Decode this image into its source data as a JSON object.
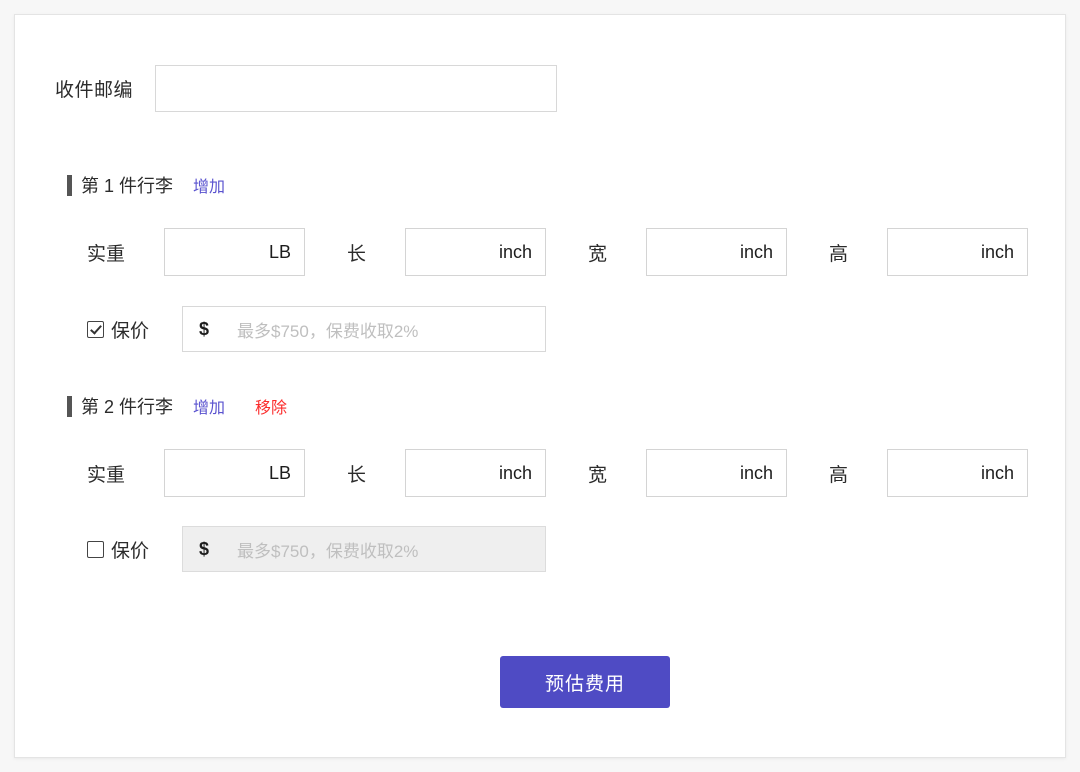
{
  "form": {
    "zipcode": {
      "label": "收件邮编",
      "value": "",
      "placeholder": ""
    },
    "units": {
      "weight": "LB",
      "length": "inch",
      "width": "inch",
      "height": "inch",
      "currency": "$"
    },
    "field_labels": {
      "weight": "实重",
      "length": "长",
      "width": "宽",
      "height": "高",
      "insurance": "保价"
    },
    "insurance_placeholder": "最多$750，保费收取2%",
    "links": {
      "add": "增加",
      "remove": "移除"
    },
    "baggage": [
      {
        "title": "第 1 件行李",
        "has_remove": false,
        "weight_value": "",
        "length_value": "",
        "width_value": "",
        "height_value": "",
        "insurance_checked": true,
        "insurance_disabled": false,
        "insurance_value": ""
      },
      {
        "title": "第 2 件行李",
        "has_remove": true,
        "weight_value": "",
        "length_value": "",
        "width_value": "",
        "height_value": "",
        "insurance_checked": false,
        "insurance_disabled": true,
        "insurance_value": ""
      }
    ],
    "submit_label": "预估费用"
  },
  "colors": {
    "accent": "#4f4bc4",
    "link": "#5a53cf",
    "danger": "#fb2b2b",
    "marker": "#555555",
    "placeholder": "#bfbfbf"
  }
}
